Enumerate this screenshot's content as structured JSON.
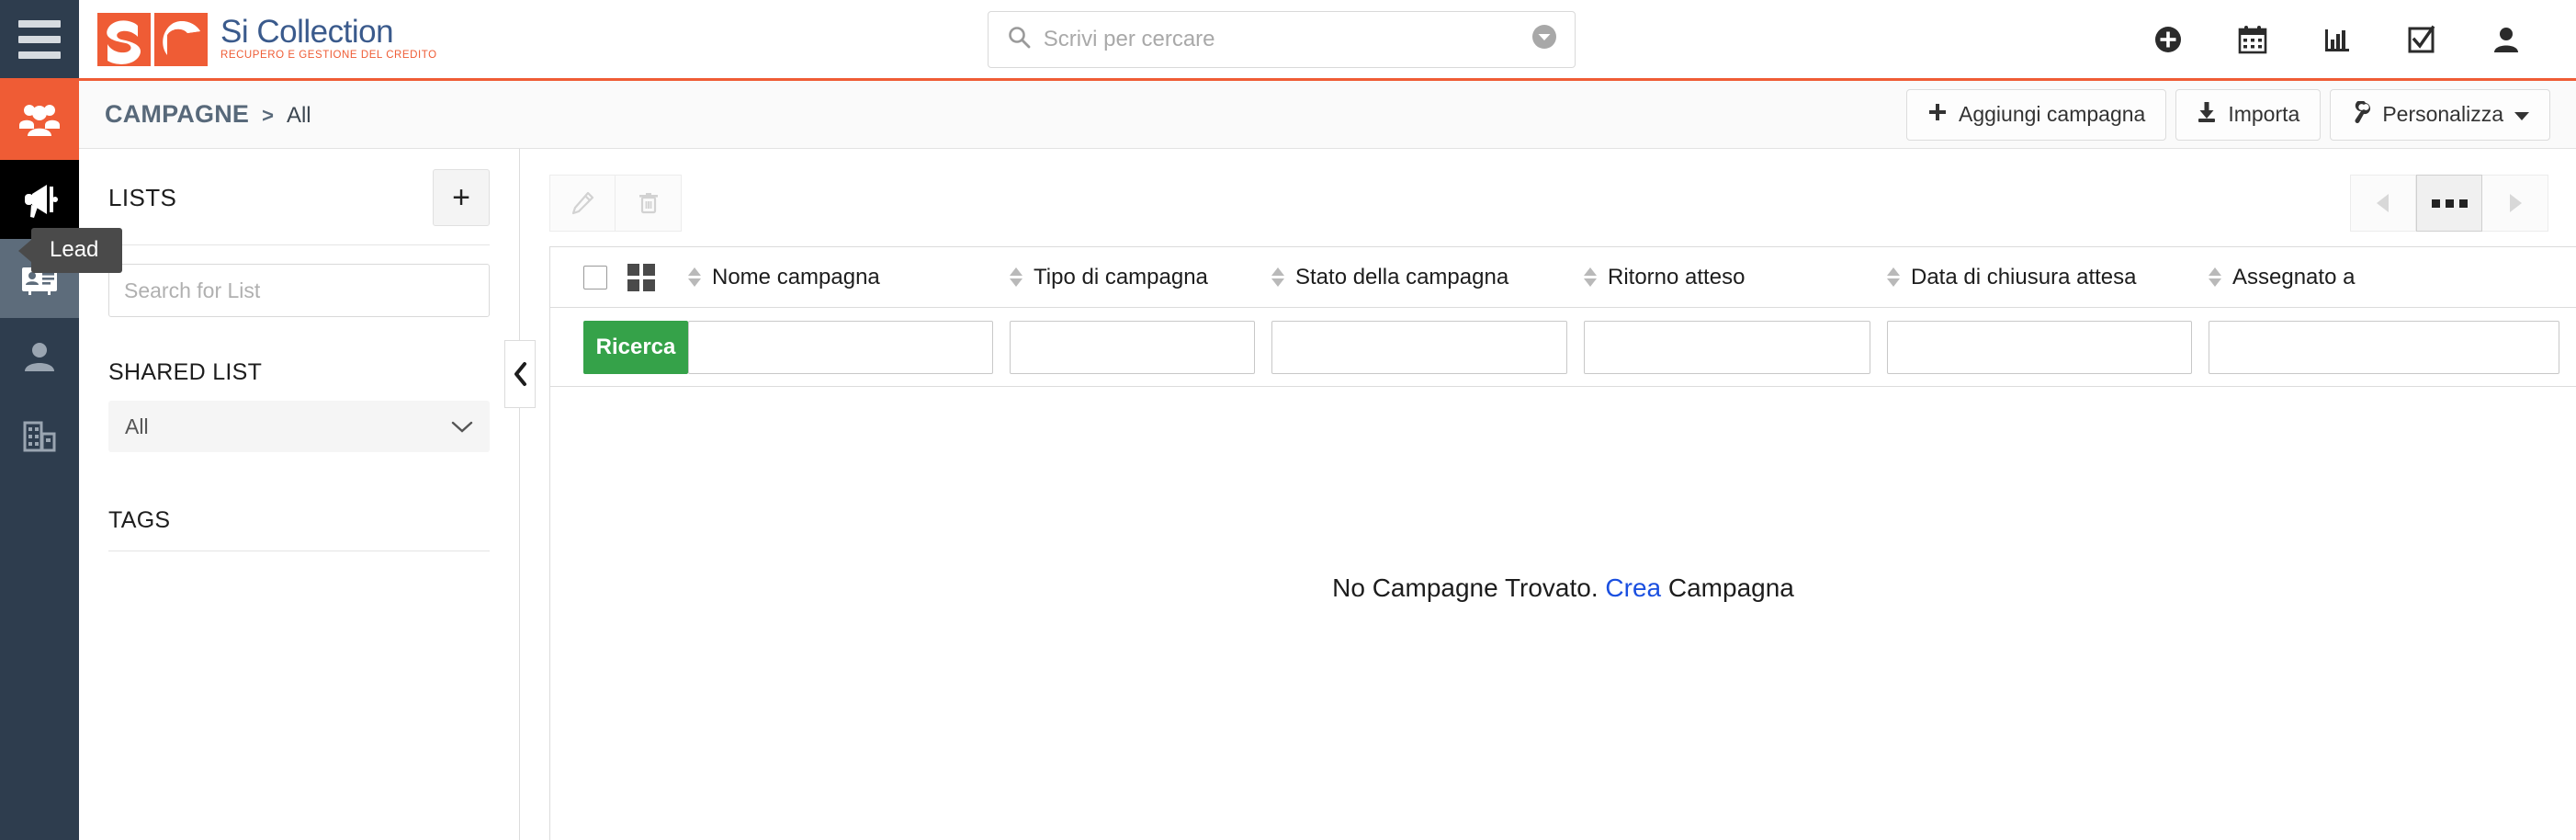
{
  "colors": {
    "brand_orange": "#ef5c35",
    "navy": "#2e3d4e",
    "green": "#35a249",
    "link_blue": "#1a4fe0",
    "logo_blue": "#3a5a8c"
  },
  "topbar": {
    "menu_icon": "hamburger-icon",
    "logo": {
      "title": "Si Collection",
      "subtitle": "RECUPERO E GESTIONE DEL CREDITO"
    },
    "search": {
      "placeholder": "Scrivi per cercare",
      "value": "",
      "icon": "search-icon",
      "caret_icon": "chevron-down-circle-icon"
    },
    "icons": [
      {
        "name": "add-circle-icon",
        "glyph": "plus-circle"
      },
      {
        "name": "calendar-icon",
        "glyph": "calendar"
      },
      {
        "name": "analytics-icon",
        "glyph": "bar-chart"
      },
      {
        "name": "tasks-icon",
        "glyph": "check-square"
      },
      {
        "name": "user-account-icon",
        "glyph": "user"
      }
    ]
  },
  "rail": {
    "items": [
      {
        "name": "sidebar-item-accounts",
        "icon": "users-group-icon",
        "state": "active"
      },
      {
        "name": "sidebar-item-campagne",
        "icon": "megaphone-icon",
        "state": "dark"
      },
      {
        "name": "sidebar-item-lead",
        "icon": "contact-card-icon",
        "state": "hover",
        "tooltip": "Lead"
      },
      {
        "name": "sidebar-item-contatti",
        "icon": "person-icon",
        "state": "normal"
      },
      {
        "name": "sidebar-item-aziende",
        "icon": "building-icon",
        "state": "normal"
      }
    ],
    "tooltip_label": "Lead"
  },
  "page_header": {
    "breadcrumb_main": "CAMPAGNE",
    "breadcrumb_separator": ">",
    "breadcrumb_sub": "All",
    "actions": [
      {
        "name": "add-campaign-button",
        "label": "Aggiungi campagna",
        "icon": "plus-icon"
      },
      {
        "name": "import-button",
        "label": "Importa",
        "icon": "download-icon"
      },
      {
        "name": "customize-button",
        "label": "Personalizza",
        "icon": "wrench-icon",
        "caret": "caret-down-icon"
      }
    ]
  },
  "lists_panel": {
    "title": "LISTS",
    "add_button_label": "+",
    "search_placeholder": "Search for List",
    "search_value": "",
    "shared_list_title": "SHARED LIST",
    "shared_list_value": "All",
    "tags_title": "TAGS"
  },
  "toolbar": {
    "edit_icon": "pencil-icon",
    "delete_icon": "trash-icon",
    "prev_icon": "caret-left-icon",
    "more_label": "•••",
    "next_icon": "caret-right-icon"
  },
  "table": {
    "select_all_name": "select-all-checkbox",
    "grid_view_icon": "grid-view-icon",
    "columns": [
      {
        "label": "Nome campagna",
        "class": "c-nome",
        "filter_value": ""
      },
      {
        "label": "Tipo di campagna",
        "class": "c-tipo",
        "filter_value": ""
      },
      {
        "label": "Stato della campagna",
        "class": "c-stato",
        "filter_value": ""
      },
      {
        "label": "Ritorno atteso",
        "class": "c-rit",
        "filter_value": ""
      },
      {
        "label": "Data di chiusura attesa",
        "class": "c-data",
        "filter_value": ""
      },
      {
        "label": "Assegnato a",
        "class": "c-ass",
        "filter_value": ""
      }
    ],
    "search_button_label": "Ricerca",
    "rows": [],
    "empty_text_before": "No Campagne Trovato. ",
    "empty_link": "Crea",
    "empty_text_after": " Campagna"
  }
}
